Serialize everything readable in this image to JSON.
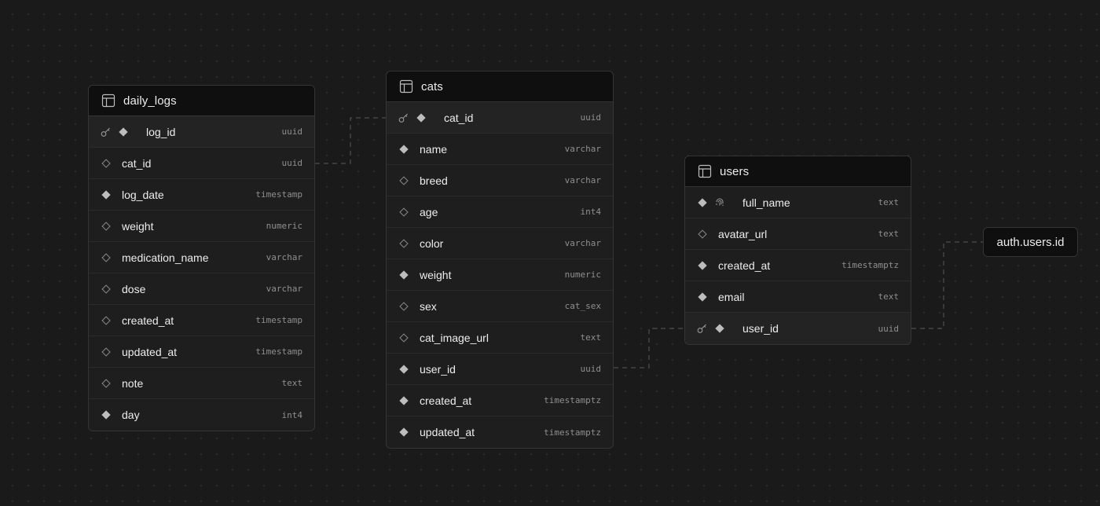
{
  "colors": {
    "background": "#1a1a1a",
    "card": "#1e1e1e",
    "header": "#0f0f0f",
    "border": "#343434",
    "text": "#ededed",
    "muted": "#8f8f8f",
    "connector": "#5a5a5a"
  },
  "tables": [
    {
      "id": "daily_logs",
      "name": "daily_logs",
      "icon": "table-icon",
      "columns": [
        {
          "name": "log_id",
          "type": "uuid",
          "primary_key": true,
          "required": true
        },
        {
          "name": "cat_id",
          "type": "uuid",
          "required": false
        },
        {
          "name": "log_date",
          "type": "timestamp",
          "required": true
        },
        {
          "name": "weight",
          "type": "numeric",
          "required": false
        },
        {
          "name": "medication_name",
          "type": "varchar",
          "required": false
        },
        {
          "name": "dose",
          "type": "varchar",
          "required": false
        },
        {
          "name": "created_at",
          "type": "timestamp",
          "required": false
        },
        {
          "name": "updated_at",
          "type": "timestamp",
          "required": false
        },
        {
          "name": "note",
          "type": "text",
          "required": false
        },
        {
          "name": "day",
          "type": "int4",
          "required": true
        }
      ]
    },
    {
      "id": "cats",
      "name": "cats",
      "icon": "table-icon",
      "columns": [
        {
          "name": "cat_id",
          "type": "uuid",
          "primary_key": true,
          "required": true
        },
        {
          "name": "name",
          "type": "varchar",
          "required": true
        },
        {
          "name": "breed",
          "type": "varchar",
          "required": false
        },
        {
          "name": "age",
          "type": "int4",
          "required": false
        },
        {
          "name": "color",
          "type": "varchar",
          "required": false
        },
        {
          "name": "weight",
          "type": "numeric",
          "required": true
        },
        {
          "name": "sex",
          "type": "cat_sex",
          "required": false
        },
        {
          "name": "cat_image_url",
          "type": "text",
          "required": false
        },
        {
          "name": "user_id",
          "type": "uuid",
          "required": true
        },
        {
          "name": "created_at",
          "type": "timestamptz",
          "required": true
        },
        {
          "name": "updated_at",
          "type": "timestamptz",
          "required": true
        }
      ]
    },
    {
      "id": "users",
      "name": "users",
      "icon": "table-icon",
      "columns": [
        {
          "name": "full_name",
          "type": "text",
          "required": true,
          "unique": true
        },
        {
          "name": "avatar_url",
          "type": "text",
          "required": false
        },
        {
          "name": "created_at",
          "type": "timestamptz",
          "required": true
        },
        {
          "name": "email",
          "type": "text",
          "required": true
        },
        {
          "name": "user_id",
          "type": "uuid",
          "primary_key": true,
          "required": true
        }
      ]
    }
  ],
  "reference": {
    "label": "auth.users.id"
  },
  "relations": [
    {
      "from": "daily_logs.cat_id",
      "to": "cats.cat_id"
    },
    {
      "from": "cats.user_id",
      "to": "users.user_id"
    },
    {
      "from": "users.user_id",
      "to": "auth.users.id"
    }
  ]
}
